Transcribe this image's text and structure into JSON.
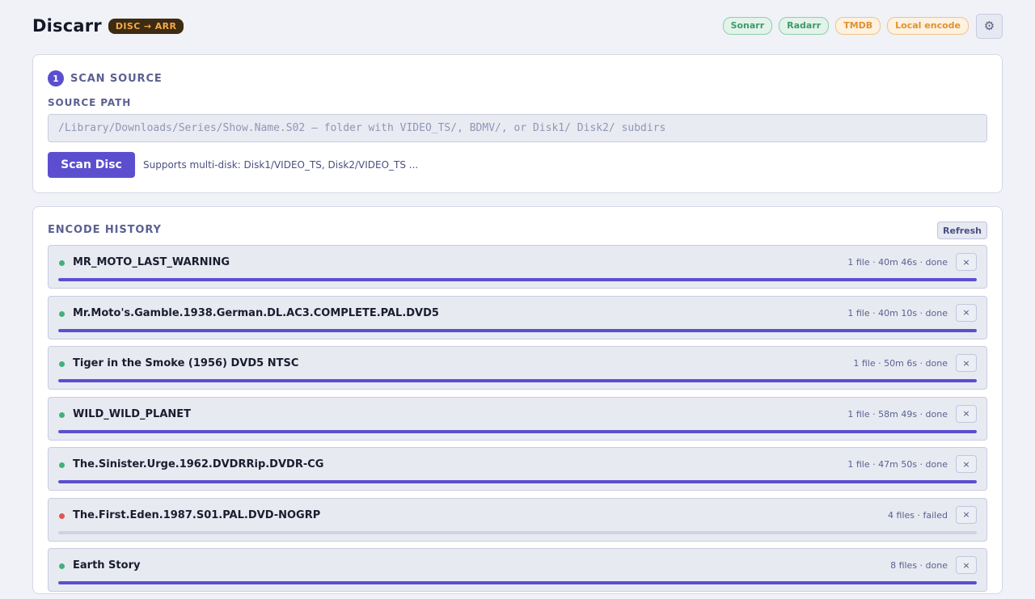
{
  "header": {
    "title": "Discarr",
    "badge": "DISC → ARR",
    "tags": [
      {
        "label": "Sonarr",
        "tone": "green"
      },
      {
        "label": "Radarr",
        "tone": "green"
      },
      {
        "label": "TMDB",
        "tone": "orange"
      },
      {
        "label": "Local encode",
        "tone": "orange"
      }
    ],
    "settings_icon": "gear-icon"
  },
  "scan": {
    "step_number": "1",
    "title": "SCAN SOURCE",
    "source_label": "SOURCE PATH",
    "source_value": "",
    "source_placeholder": "/Library/Downloads/Series/Show.Name.S02 — folder with VIDEO_TS/, BDMV/, or Disk1/ Disk2/ subdirs",
    "scan_button": "Scan Disc",
    "hint": "Supports multi-disk: Disk1/VIDEO_TS, Disk2/VIDEO_TS ..."
  },
  "history": {
    "title": "ENCODE HISTORY",
    "refresh_label": "Refresh",
    "remove_label": "×",
    "jobs": [
      {
        "name": "MR_MOTO_LAST_WARNING",
        "meta": "1 file · 40m 46s · done",
        "status": "done",
        "progress": 1.0
      },
      {
        "name": "Mr.Moto's.Gamble.1938.German.DL.AC3.COMPLETE.PAL.DVD5",
        "meta": "1 file · 40m 10s · done",
        "status": "done",
        "progress": 1.0
      },
      {
        "name": "Tiger in the Smoke (1956) DVD5 NTSC",
        "meta": "1 file · 50m 6s · done",
        "status": "done",
        "progress": 1.0
      },
      {
        "name": "WILD_WILD_PLANET",
        "meta": "1 file · 58m 49s · done",
        "status": "done",
        "progress": 1.0
      },
      {
        "name": "The.Sinister.Urge.1962.DVDRRip.DVDR-CG",
        "meta": "1 file · 47m 50s · done",
        "status": "done",
        "progress": 1.0
      },
      {
        "name": "The.First.Eden.1987.S01.PAL.DVD-NOGRP",
        "meta": "4 files · failed",
        "status": "failed",
        "progress": 0.0
      },
      {
        "name": "Earth Story",
        "meta": "8 files · done",
        "status": "done",
        "progress": 1.0
      }
    ]
  },
  "colors": {
    "accent": "#5b4fcf",
    "done": "#3fb27a",
    "failed": "#e25555"
  }
}
